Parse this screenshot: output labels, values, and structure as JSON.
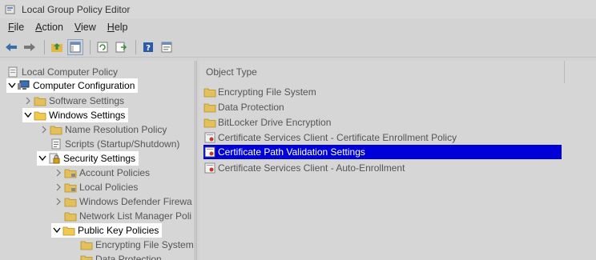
{
  "window": {
    "title": "Local Group Policy Editor"
  },
  "menu": [
    {
      "key": "F",
      "rest": "ile"
    },
    {
      "key": "A",
      "rest": "ction"
    },
    {
      "key": "V",
      "rest": "iew"
    },
    {
      "key": "H",
      "rest": "elp"
    }
  ],
  "tree": {
    "root": "Local Computer Policy",
    "computer_configuration": "Computer Configuration",
    "software_settings": "Software Settings",
    "windows_settings": "Windows Settings",
    "name_resolution_policy": "Name Resolution Policy",
    "scripts": "Scripts (Startup/Shutdown)",
    "security_settings": "Security Settings",
    "account_policies": "Account Policies",
    "local_policies": "Local Policies",
    "windows_defender_firewall": "Windows Defender Firewa",
    "network_list_manager": "Network List Manager Poli",
    "public_key_policies": "Public Key Policies",
    "encrypting_file_system": "Encrypting File System",
    "data_protection": "Data Protection"
  },
  "list": {
    "column_header": "Object Type",
    "items": [
      "Encrypting File System",
      "Data Protection",
      "BitLocker Drive Encryption",
      "Certificate Services Client - Certificate Enrollment Policy",
      "Certificate Path Validation Settings",
      "Certificate Services Client - Auto-Enrollment"
    ],
    "selected_index": 4
  },
  "colors": {
    "selection": "#0000d8",
    "folder": "#f2c94c",
    "background": "#d6d6d6"
  }
}
